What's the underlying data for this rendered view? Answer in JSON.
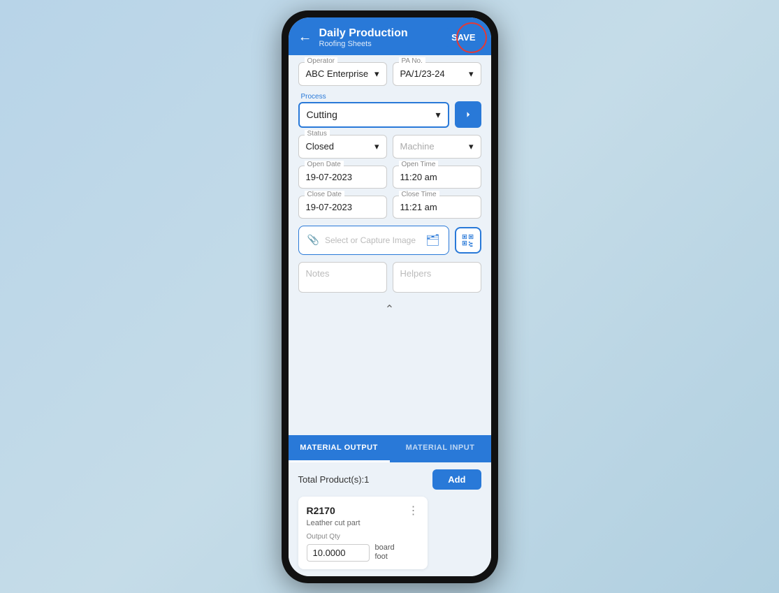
{
  "header": {
    "title": "Daily Production",
    "subtitle": "Roofing Sheets",
    "save_label": "SAVE",
    "back_icon": "←"
  },
  "operator": {
    "label": "Operator",
    "value": "ABC Enterprise",
    "icon": "chevron-down"
  },
  "pa_no": {
    "label": "PA No.",
    "value": "PA/1/23-24",
    "icon": "chevron-down"
  },
  "process": {
    "label": "Process",
    "value": "Cutting",
    "icon": "chevron-down",
    "arrow_icon": "→"
  },
  "status": {
    "label": "Status",
    "value": "Closed",
    "icon": "chevron-down"
  },
  "machine": {
    "label": "",
    "placeholder": "Machine",
    "icon": "chevron-down"
  },
  "open_date": {
    "label": "Open Date",
    "value": "19-07-2023"
  },
  "open_time": {
    "label": "Open Time",
    "value": "11:20 am"
  },
  "close_date": {
    "label": "Close Date",
    "value": "19-07-2023"
  },
  "close_time": {
    "label": "Close Time",
    "value": "11:21 am"
  },
  "image_picker": {
    "placeholder": "Select or Capture Image"
  },
  "notes": {
    "placeholder": "Notes"
  },
  "helpers": {
    "placeholder": "Helpers"
  },
  "tabs": [
    {
      "label": "MATERIAL OUTPUT",
      "active": true
    },
    {
      "label": "MATERIAL INPUT",
      "active": false
    }
  ],
  "material_output": {
    "total_label": "Total Product(s):1",
    "add_label": "Add",
    "product": {
      "code": "R2170",
      "name": "Leather cut  part",
      "output_qty_label": "Output Qty",
      "output_qty_value": "10.0000",
      "unit_line1": "board",
      "unit_line2": "foot",
      "menu_icon": "⋮"
    }
  }
}
